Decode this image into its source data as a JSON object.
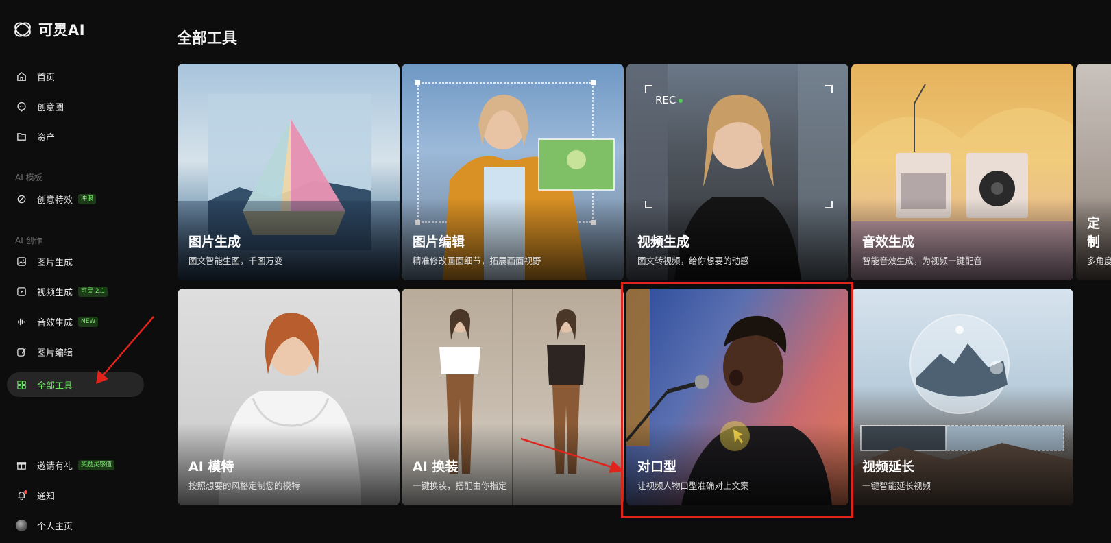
{
  "app": {
    "name": "可灵AI"
  },
  "sidebar": {
    "top_items": [
      {
        "label": "首页",
        "icon": "home-icon"
      },
      {
        "label": "创意圈",
        "icon": "chat-bubble-icon"
      },
      {
        "label": "资产",
        "icon": "folder-icon"
      }
    ],
    "section_templates": "AI 模板",
    "templates_item": {
      "label": "创意特效",
      "badge": "冲浪",
      "icon": "effects-icon"
    },
    "section_create": "AI 创作",
    "create_items": [
      {
        "label": "图片生成",
        "icon": "image-icon",
        "badge": ""
      },
      {
        "label": "视频生成",
        "icon": "video-icon",
        "badge": "可灵 2.1"
      },
      {
        "label": "音效生成",
        "icon": "audio-icon",
        "badge": "NEW"
      },
      {
        "label": "图片编辑",
        "icon": "image-edit-icon",
        "badge": ""
      },
      {
        "label": "全部工具",
        "icon": "grid-icon",
        "badge": "",
        "active": true
      }
    ],
    "bottom_items": [
      {
        "label": "邀请有礼",
        "icon": "gift-icon",
        "badge": "奖励灵感值"
      },
      {
        "label": "通知",
        "icon": "bell-icon"
      },
      {
        "label": "个人主页",
        "icon": "avatar"
      }
    ]
  },
  "main": {
    "title": "全部工具",
    "cards": [
      {
        "title": "图片生成",
        "desc": "图文智能生图，千图万变"
      },
      {
        "title": "图片编辑",
        "desc": "精准修改画面细节，拓展画面视野"
      },
      {
        "title": "视频生成",
        "desc": "图文转视频，给你想要的动感",
        "overlay": "REC"
      },
      {
        "title": "音效生成",
        "desc": "智能音效生成，为视频一键配音"
      },
      {
        "title": "定制",
        "desc": "多角度"
      },
      {
        "title": "AI 模特",
        "desc": "按照想要的风格定制您的模特"
      },
      {
        "title": "AI 换装",
        "desc": "一键换装，搭配由你指定"
      },
      {
        "title": "对口型",
        "desc": "让视频人物口型准确对上文案"
      },
      {
        "title": "视频延长",
        "desc": "一键智能延长视频"
      }
    ]
  },
  "colors": {
    "accent": "#74e36a",
    "highlight": "#e0231b",
    "background": "#0d0d0d"
  }
}
